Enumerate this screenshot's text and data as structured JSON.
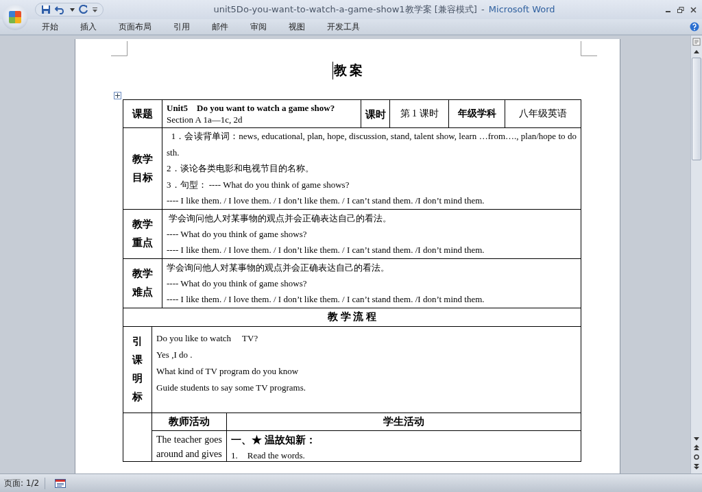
{
  "window": {
    "title": "unit5Do-you-want-to-watch-a-game-show1教学案 [兼容模式]",
    "separator": "-",
    "app_name": "Microsoft Word"
  },
  "ribbon_tabs": [
    {
      "label": "开始"
    },
    {
      "label": "插入"
    },
    {
      "label": "页面布局"
    },
    {
      "label": "引用"
    },
    {
      "label": "邮件"
    },
    {
      "label": "审阅"
    },
    {
      "label": "视图"
    },
    {
      "label": "开发工具"
    }
  ],
  "document": {
    "heading": "教 案",
    "header_row": {
      "label": "课题",
      "title": "Unit5　Do you want to watch a game show?",
      "subtitle": "Section A 1a—1c, 2d",
      "period_label": "课时",
      "period": "第 1 课时",
      "subject_label": "年级学科",
      "subject": "八年级英语"
    },
    "sections": [
      {
        "label": "教学目标",
        "lines": [
          "  1．会读背单词：news, educational, plan, hope, discussion, stand, talent show, learn …from…., plan/hope to do sth.",
          "2．谈论各类电影和电视节目的名称。",
          "3．句型： ---- What do you think of game shows?",
          "---- I like them. / I love them. / I don’t like them. / I can’t stand them. /I don’t mind them."
        ]
      },
      {
        "label": "教学重点",
        "lines": [
          " 学会询问他人对某事物的观点并会正确表达自己的看法。",
          "---- What do you think of game shows?",
          "---- I like them. / I love them. / I don’t like them. / I can’t stand them. /I don’t mind them."
        ]
      },
      {
        "label": "教学难点",
        "lines": [
          "学会询问他人对某事物的观点并会正确表达自己的看法。",
          "---- What do you think of game shows?",
          "---- I like them. / I love them. / I don’t like them. / I can’t stand them. /I don’t mind them."
        ]
      }
    ],
    "flow_heading": "教 学 流 程",
    "intro": {
      "label": "引课明标",
      "lines": [
        "Do you like to watch     TV?",
        "Yes ,I do .",
        "What kind of TV program do you know",
        "Guide students to say some TV programs."
      ]
    },
    "activities": {
      "teacher_heading": "教师活动",
      "student_heading": "学生活动",
      "teacher_text": "The teacher goes around and gives",
      "student_title": "一、★ 温故知新：",
      "student_items": [
        {
          "number": "1.",
          "text": "Read the words."
        }
      ]
    }
  },
  "status_bar": {
    "page": "页面: 1/2"
  }
}
